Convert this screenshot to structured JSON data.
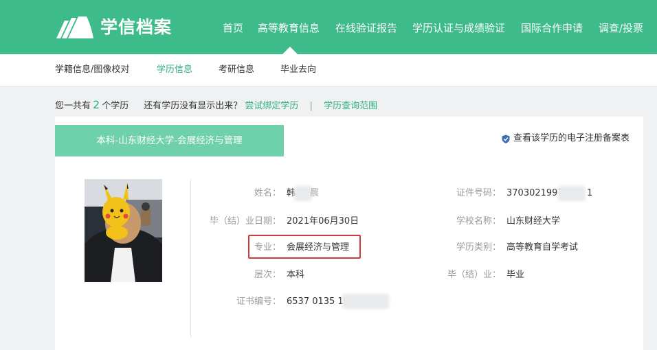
{
  "header": {
    "logo_text": "学信档案",
    "nav": [
      "首页",
      "高等教育信息",
      "在线验证报告",
      "学历认证与成绩验证",
      "国际合作申请",
      "调查/投票"
    ],
    "active_index": 1
  },
  "subnav": {
    "items": [
      "学籍信息/图像校对",
      "学历信息",
      "考研信息",
      "毕业去向"
    ],
    "active_index": 1
  },
  "summary": {
    "prefix": "您一共有",
    "count": "2",
    "suffix": "个学历",
    "missing_text": "还有学历没有显示出来？",
    "bind_link": "尝试绑定学历",
    "separator": "|",
    "scope_link": "学历查询范围"
  },
  "record": {
    "tab_title": "本科-山东财经大学-会展经济与管理",
    "register_link": "查看该学历的电子注册备案表",
    "fields": {
      "name_label": "姓名：",
      "name_value": "韩",
      "name_value_tail": "晨",
      "id_label": "证件号码：",
      "id_value": "37030219979",
      "id_value_tail": "1",
      "grad_date_label": "毕（结）业日期：",
      "grad_date_value": "2021年06月30日",
      "school_label": "学校名称：",
      "school_value": "山东财经大学",
      "major_label": "专业：",
      "major_value": "会展经济与管理",
      "type_label": "学历类别：",
      "type_value": "高等教育自学考试",
      "level_label": "层次：",
      "level_value": "本科",
      "result_label": "毕（结）业：",
      "result_value": "毕业",
      "cert_label": "证书编号：",
      "cert_value": "6537 0135 19"
    }
  },
  "colors": {
    "brand": "#3dbb8a",
    "tab": "#6fd1ab",
    "link": "#2fae7b",
    "highlight": "#d2393a"
  }
}
